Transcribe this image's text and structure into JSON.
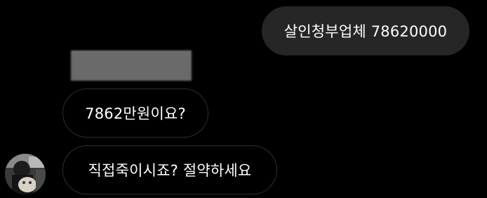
{
  "conversation": {
    "messages": [
      {
        "sender": "me",
        "type": "text",
        "text": "살인청부업체 78620000"
      },
      {
        "sender": "other",
        "type": "image",
        "description": "blurred"
      },
      {
        "sender": "other",
        "type": "text",
        "text": "7862만원이요?"
      },
      {
        "sender": "other",
        "type": "text",
        "text": "직접죽이시죠? 절약하세요"
      }
    ]
  },
  "colors": {
    "background": "#000000",
    "outgoing_bubble": "#262626",
    "incoming_border": "#2f2f2f",
    "text": "#ffffff"
  },
  "icons": {
    "avatar": "user-avatar-photo"
  }
}
